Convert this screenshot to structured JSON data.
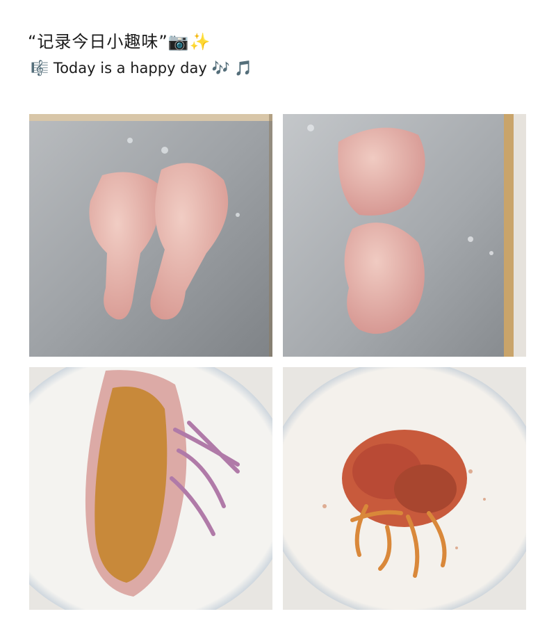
{
  "post": {
    "title": "“记录今日小趣味”📷✨",
    "subtitle": "🎼 Today is a happy day 🎶 🎵"
  },
  "photos": [
    {
      "icon": "raw-chicken-drumsticks-on-tray"
    },
    {
      "icon": "deboned-chicken-on-tray"
    },
    {
      "icon": "chicken-with-spices-and-onion"
    },
    {
      "icon": "marinated-chicken-on-plate"
    }
  ]
}
